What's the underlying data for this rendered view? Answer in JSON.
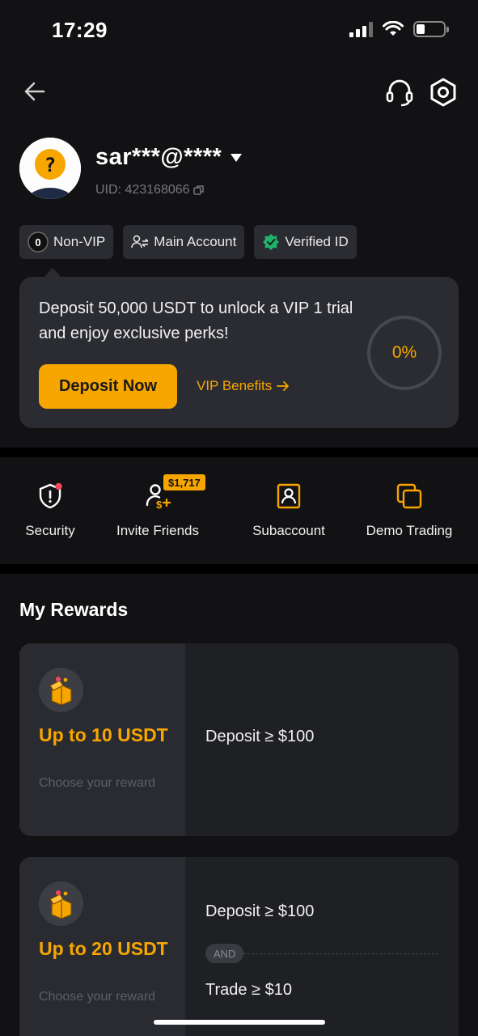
{
  "status_bar": {
    "time": "17:29",
    "signal_bars": 4,
    "signal_active": 3,
    "battery_level": 0.25
  },
  "nav": {
    "back_icon": "arrow-left-icon",
    "support_icon": "headset-icon",
    "settings_icon": "hexagon-settings-icon"
  },
  "profile": {
    "username": "sar***@****",
    "uid": "UID: 423168066",
    "badges": [
      {
        "label": "Non-VIP",
        "icon": "vip-level-icon",
        "level": "0"
      },
      {
        "label": "Main Account",
        "icon": "account-switch-icon"
      },
      {
        "label": "Verified ID",
        "icon": "verified-badge-icon"
      }
    ]
  },
  "vip_card": {
    "message": "Deposit 50,000 USDT to unlock a VIP 1 trial and enjoy exclusive perks!",
    "deposit_button": "Deposit Now",
    "benefits_link": "VIP Benefits",
    "progress": "0%"
  },
  "quick_actions": [
    {
      "label": "Security",
      "icon": "shield-alert-icon"
    },
    {
      "label": "Invite Friends",
      "icon": "invite-friends-icon",
      "badge": "$1,717"
    },
    {
      "label": "Subaccount",
      "icon": "subaccount-icon"
    },
    {
      "label": "Demo Trading",
      "icon": "demo-trading-icon"
    }
  ],
  "rewards": {
    "title": "My Rewards",
    "cards": [
      {
        "amount": "Up to 10 USDT",
        "subtitle": "Choose your reward",
        "conditions": [
          "Deposit ≥ $100"
        ]
      },
      {
        "amount": "Up to 20 USDT",
        "subtitle": "Choose your reward",
        "conditions": [
          "Deposit ≥ $100",
          "Trade ≥ $10"
        ],
        "joiner": "AND"
      }
    ]
  },
  "colors": {
    "accent": "#f7a600",
    "background": "#121214",
    "card": "#2b2c31",
    "verified": "#20b26c",
    "alert": "#f6465d"
  }
}
